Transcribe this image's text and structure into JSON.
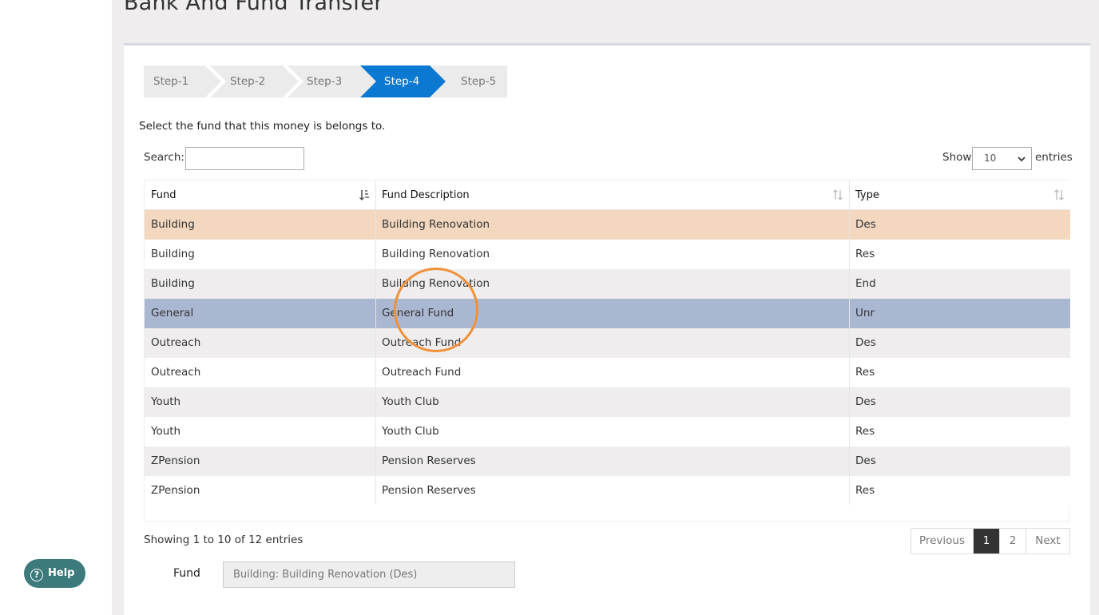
{
  "page": {
    "title": "Bank And Fund Transfer"
  },
  "steps": [
    {
      "label": "Step-1",
      "active": false
    },
    {
      "label": "Step-2",
      "active": false
    },
    {
      "label": "Step-3",
      "active": false
    },
    {
      "label": "Step-4",
      "active": true
    },
    {
      "label": "Step-5",
      "active": false
    }
  ],
  "instruction": "Select the fund that this money is belongs to.",
  "search": {
    "label": "Search:",
    "value": ""
  },
  "length": {
    "show_label": "Show",
    "value": "10",
    "entries_label": "entries"
  },
  "table": {
    "columns": [
      "Fund",
      "Fund Description",
      "Type"
    ],
    "rows": [
      {
        "fund": "Building",
        "description": "Building Renovation",
        "type": "Des",
        "state": "selected"
      },
      {
        "fund": "Building",
        "description": "Building Renovation",
        "type": "Res",
        "state": ""
      },
      {
        "fund": "Building",
        "description": "Building Renovation",
        "type": "End",
        "state": ""
      },
      {
        "fund": "General",
        "description": "General Fund",
        "type": "Unr",
        "state": "hover"
      },
      {
        "fund": "Outreach",
        "description": "Outreach Fund",
        "type": "Des",
        "state": ""
      },
      {
        "fund": "Outreach",
        "description": "Outreach Fund",
        "type": "Res",
        "state": ""
      },
      {
        "fund": "Youth",
        "description": "Youth Club",
        "type": "Des",
        "state": ""
      },
      {
        "fund": "Youth",
        "description": "Youth Club",
        "type": "Res",
        "state": ""
      },
      {
        "fund": "ZPension",
        "description": "Pension Reserves",
        "type": "Des",
        "state": ""
      },
      {
        "fund": "ZPension",
        "description": "Pension Reserves",
        "type": "Res",
        "state": ""
      }
    ]
  },
  "info": "Showing 1 to 10 of 12 entries",
  "pagination": {
    "previous": "Previous",
    "pages": [
      "1",
      "2"
    ],
    "current": "1",
    "next": "Next"
  },
  "selected_fund": {
    "label": "Fund",
    "value": "Building: Building Renovation (Des)"
  },
  "help": {
    "label": "Help"
  },
  "colors": {
    "accent": "#0b78d1",
    "selected_row": "#f3d7bf",
    "hover_row": "#aab7d1",
    "help_button": "#3d7a7b",
    "click_ring": "#f0913a"
  }
}
